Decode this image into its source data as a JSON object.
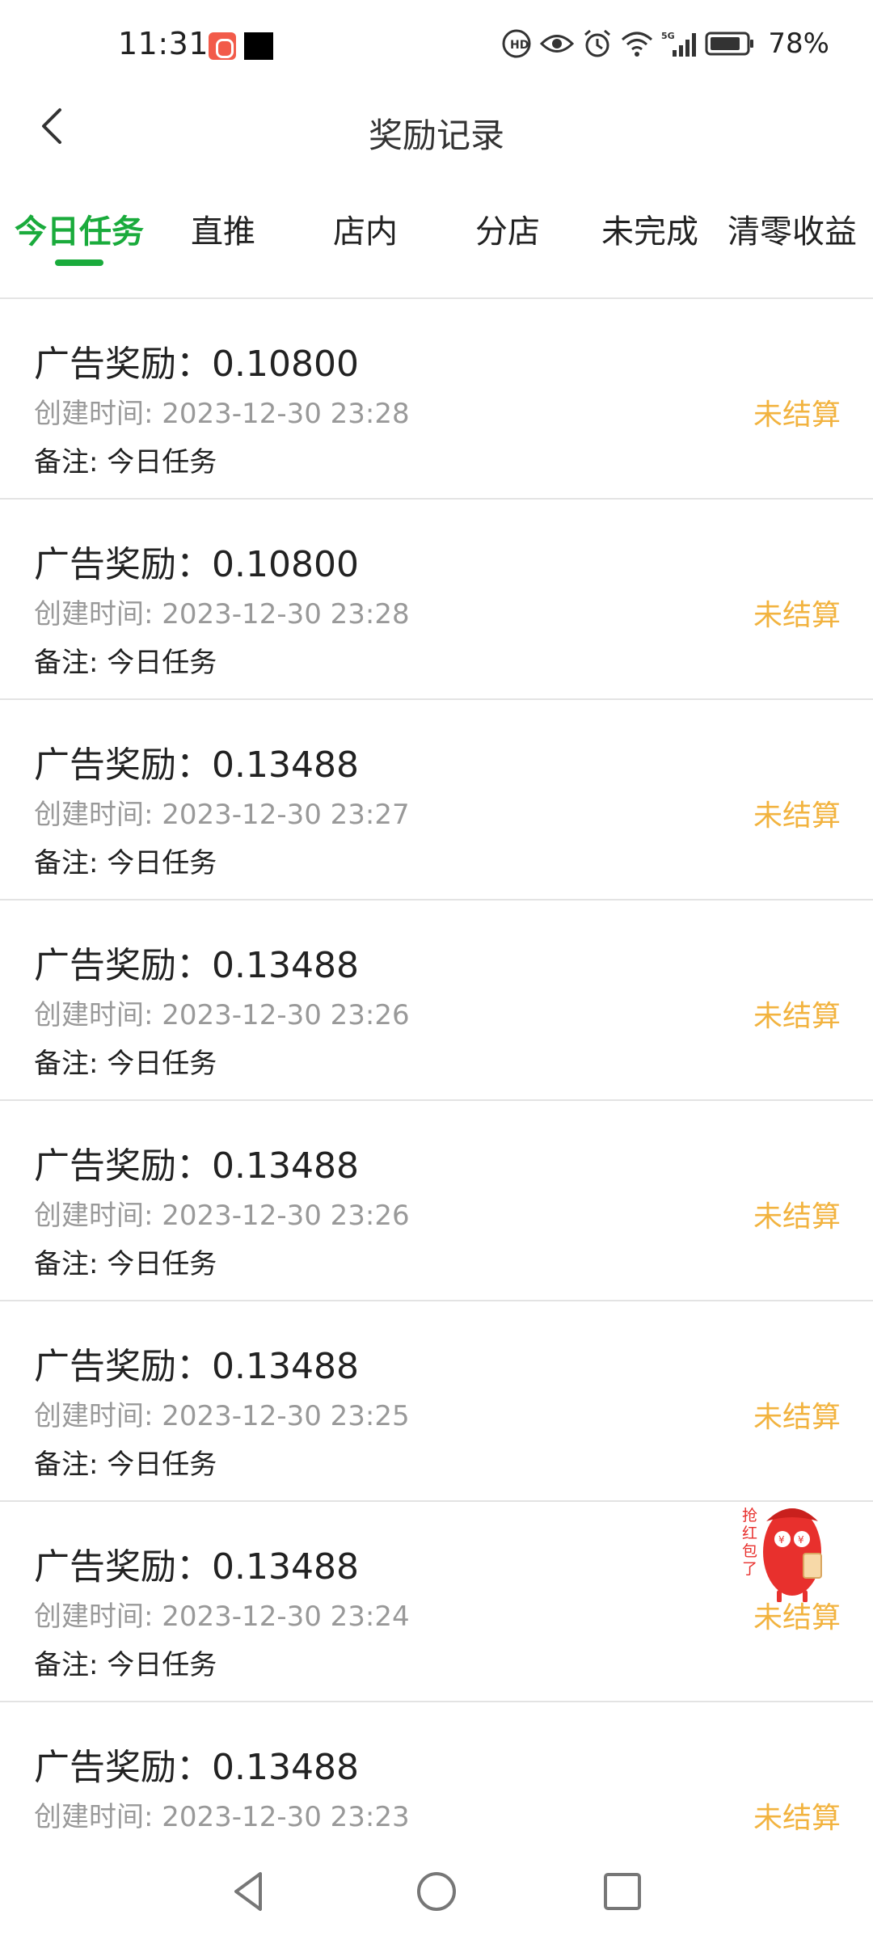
{
  "status_bar": {
    "time": "11:31",
    "network": "5G",
    "battery_percent": "78%",
    "icons": [
      "app-notification-icon",
      "black-square-icon",
      "hd-call-icon",
      "eye-icon",
      "alarm-icon",
      "wifi-icon",
      "signal-icon",
      "battery-icon"
    ]
  },
  "header": {
    "title": "奖励记录",
    "back_icon": "chevron-left-icon"
  },
  "tabs": [
    {
      "label": "今日任务",
      "active": true
    },
    {
      "label": "直推",
      "active": false
    },
    {
      "label": "店内",
      "active": false
    },
    {
      "label": "分店",
      "active": false
    },
    {
      "label": "未完成",
      "active": false
    },
    {
      "label": "清零收益",
      "active": false
    }
  ],
  "records": [
    {
      "title": "广告奖励：0.10800",
      "time": "创建时间: 2023-12-30 23:28",
      "note": "备注: 今日任务",
      "status": "未结算"
    },
    {
      "title": "广告奖励：0.10800",
      "time": "创建时间: 2023-12-30 23:28",
      "note": "备注: 今日任务",
      "status": "未结算"
    },
    {
      "title": "广告奖励：0.13488",
      "time": "创建时间: 2023-12-30 23:27",
      "note": "备注: 今日任务",
      "status": "未结算"
    },
    {
      "title": "广告奖励：0.13488",
      "time": "创建时间: 2023-12-30 23:26",
      "note": "备注: 今日任务",
      "status": "未结算"
    },
    {
      "title": "广告奖励：0.13488",
      "time": "创建时间: 2023-12-30 23:26",
      "note": "备注: 今日任务",
      "status": "未结算"
    },
    {
      "title": "广告奖励：0.13488",
      "time": "创建时间: 2023-12-30 23:25",
      "note": "备注: 今日任务",
      "status": "未结算"
    },
    {
      "title": "广告奖励：0.13488",
      "time": "创建时间: 2023-12-30 23:24",
      "note": "备注: 今日任务",
      "status": "未结算"
    },
    {
      "title": "广告奖励：0.13488",
      "time": "创建时间: 2023-12-30 23:23",
      "note": "",
      "status": "未结算"
    }
  ],
  "floating_redpack": {
    "label": "抢红包了",
    "icon": "red-envelope-mascot-icon"
  },
  "system_nav": {
    "buttons": [
      "back-triangle-icon",
      "home-circle-icon",
      "recents-square-icon"
    ]
  },
  "colors": {
    "accent_green": "#1aab3c",
    "status_orange": "#f2b33f",
    "mascot_red": "#e8302d"
  }
}
